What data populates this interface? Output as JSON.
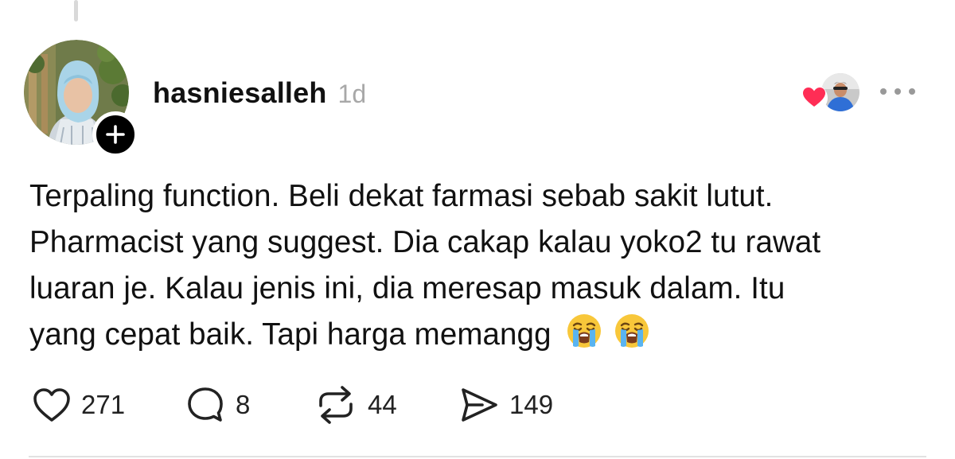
{
  "post": {
    "username": "hasniesalleh",
    "timestamp": "1d",
    "text_lines": [
      "Terpaling function. Beli dekat farmasi sebab sakit lutut.",
      "Pharmacist yang suggest. Dia cakap kalau yoko2 tu rawat",
      "luaran je. Kalau jenis ini, dia meresap masuk dalam. Itu",
      "yang cepat baik. Tapi harga memangg"
    ],
    "emojis": [
      "loudly-crying-face-emoji",
      "loudly-crying-face-emoji"
    ]
  },
  "actions": {
    "likes": "271",
    "replies": "8",
    "reposts": "44",
    "shares": "149"
  },
  "icons": {
    "follow": "plus-icon",
    "reaction": "heart-icon",
    "more": "more-horizontal-icon",
    "like": "heart-outline-icon",
    "reply": "comment-icon",
    "repost": "repost-icon",
    "share": "send-icon"
  },
  "colors": {
    "text": "#111111",
    "muted": "#a8a8a8",
    "heart_red": "#ff2d55",
    "follow_bg": "#000000"
  }
}
